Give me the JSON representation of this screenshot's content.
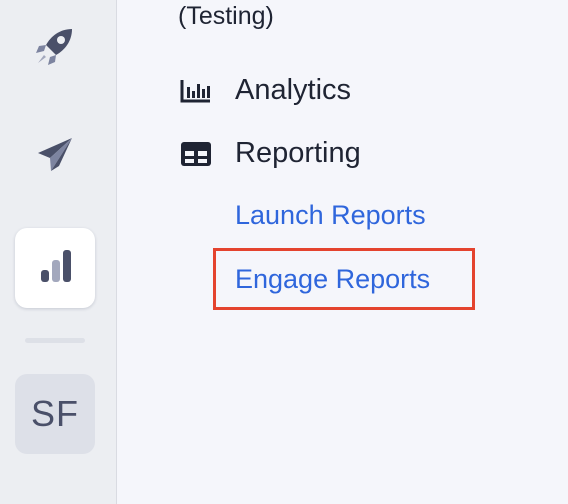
{
  "rail": {
    "items": [
      {
        "icon": "rocket-icon"
      },
      {
        "icon": "paper-plane-icon"
      },
      {
        "icon": "bar-chart-icon",
        "active": true
      }
    ],
    "avatar_initials": "SF"
  },
  "menu": {
    "workspace_suffix": "(Testing)",
    "items": [
      {
        "icon": "analytics-icon",
        "label": "Analytics"
      },
      {
        "icon": "table-icon",
        "label": "Reporting"
      }
    ],
    "reporting_links": [
      {
        "label": "Launch Reports"
      },
      {
        "label": "Engage Reports",
        "highlighted": true
      }
    ]
  },
  "colors": {
    "link": "#2f66dc",
    "highlight_border": "#e4432e",
    "icon_dark": "#4a5069",
    "background": "#f5f6fb"
  }
}
